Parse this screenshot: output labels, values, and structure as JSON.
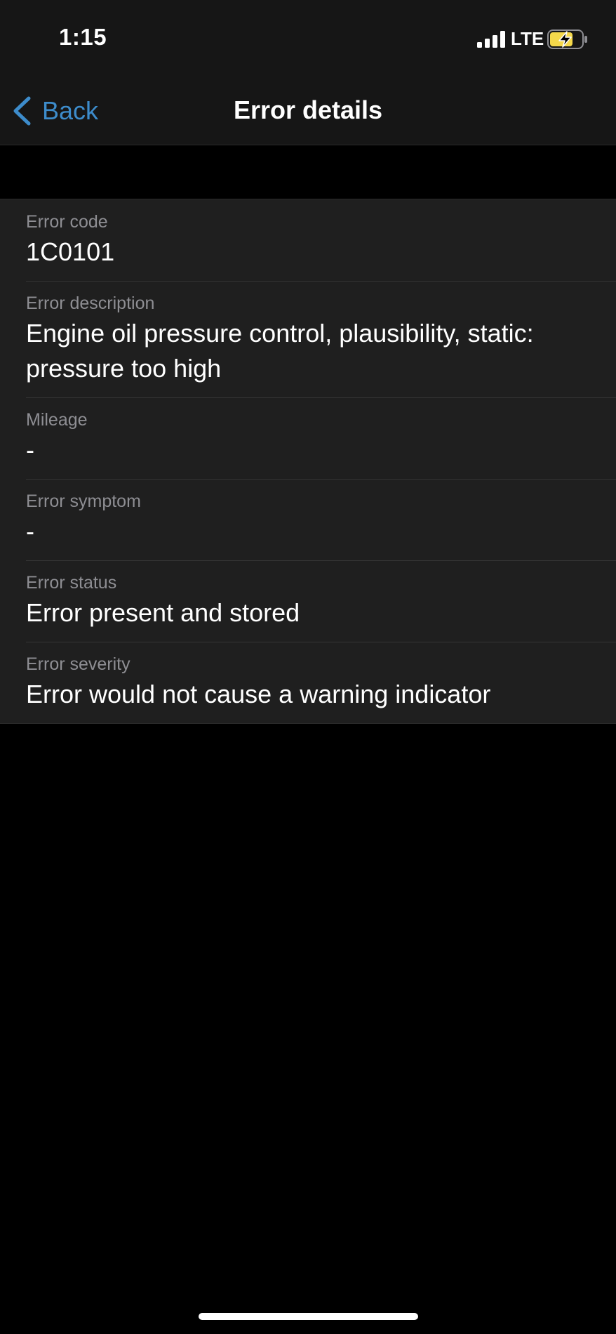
{
  "status_bar": {
    "time": "1:15",
    "network": "LTE",
    "icons": [
      "signal-icon",
      "battery-charging-icon"
    ]
  },
  "nav": {
    "back_label": "Back",
    "title": "Error details"
  },
  "details": [
    {
      "label": "Error code",
      "value": "1C0101"
    },
    {
      "label": "Error description",
      "value": "Engine oil pressure control, plausibility, static: pressure too high"
    },
    {
      "label": "Mileage",
      "value": "-"
    },
    {
      "label": "Error symptom",
      "value": "-"
    },
    {
      "label": "Error status",
      "value": "Error present and stored"
    },
    {
      "label": "Error severity",
      "value": "Error would not cause a warning indicator"
    }
  ],
  "colors": {
    "accent": "#3d8ccb",
    "background": "#000000",
    "bar_background": "#161616",
    "cell_background": "#1f1f1f",
    "label_text": "#8e8e93",
    "battery_fill": "#f5d94b"
  }
}
